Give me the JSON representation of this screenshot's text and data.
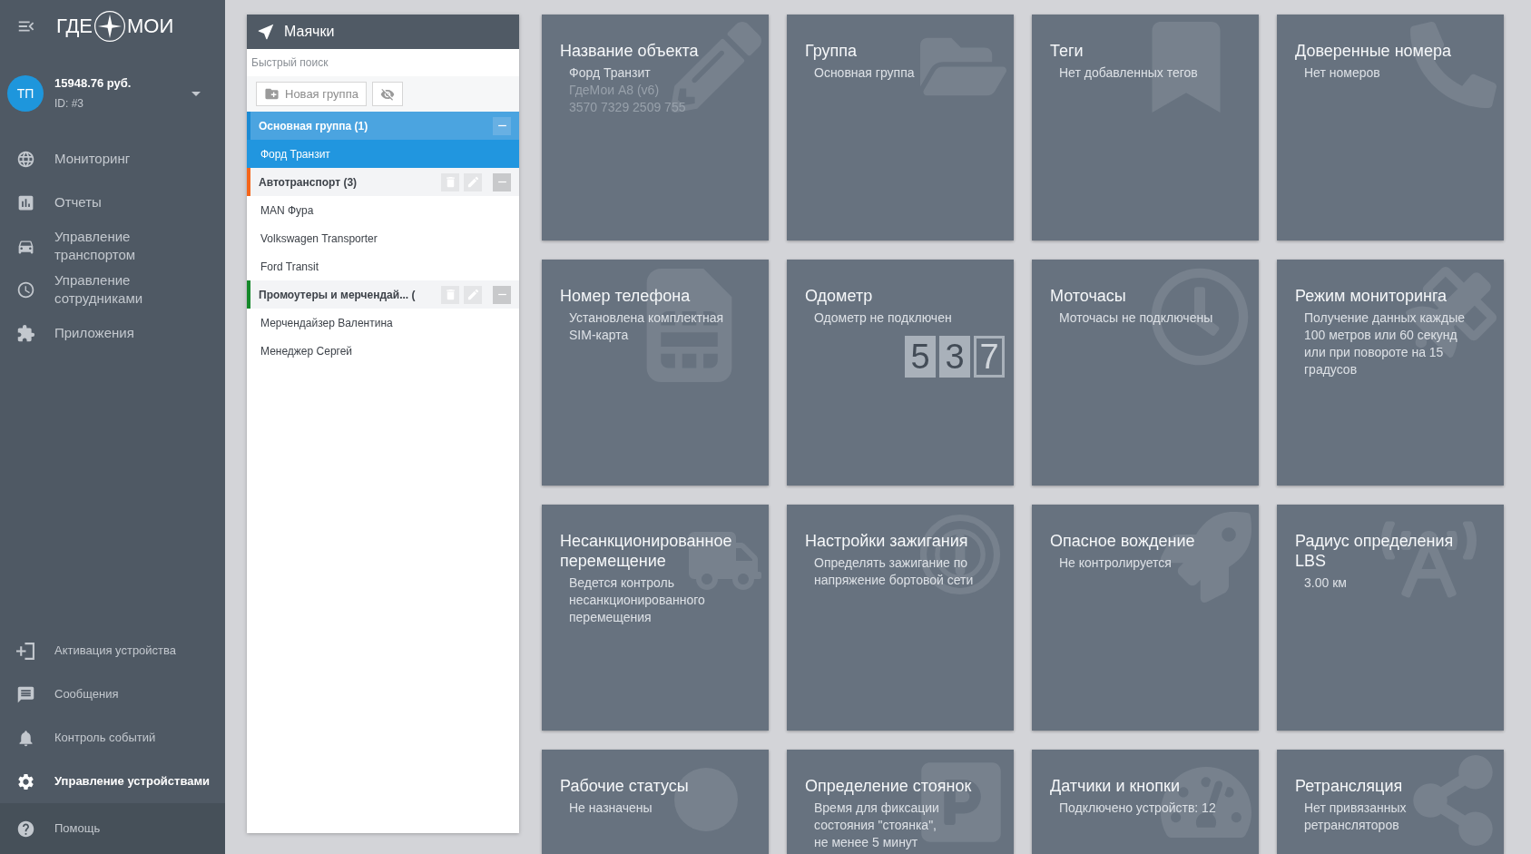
{
  "sidebar": {
    "logo": {
      "left": "ГДЕ",
      "right": "МОИ"
    },
    "account": {
      "initials": "ТП",
      "balance": "15948.76 руб.",
      "id": "ID: #3"
    },
    "nav": [
      {
        "label": "Мониторинг",
        "selected": false
      },
      {
        "label": "Отчеты",
        "selected": false
      },
      {
        "label": "Управление транспортом",
        "selected": false
      },
      {
        "label": "Управление сотрудниками",
        "selected": false
      },
      {
        "label": "Приложения",
        "selected": false
      }
    ],
    "bottom_nav": [
      {
        "label": "Активация устройства",
        "selected": false
      },
      {
        "label": "Сообщения",
        "selected": false
      },
      {
        "label": "Контроль событий",
        "selected": false
      },
      {
        "label": "Управление устройствами",
        "selected": true
      }
    ],
    "help": {
      "label": "Помощь"
    }
  },
  "beacons_panel": {
    "title": "Маячки",
    "search": {
      "placeholder": "Быстрый поиск"
    },
    "new_group_button": "Новая группа",
    "groups": [
      {
        "name": "Основная группа (1)",
        "color": "#1b8ad3",
        "selected": true,
        "expanded": true,
        "editable": false,
        "items": [
          {
            "name": "Форд Транзит",
            "selected": true
          }
        ]
      },
      {
        "name": "Автотранспорт (3)",
        "color": "#f5661b",
        "selected": false,
        "expanded": true,
        "editable": true,
        "items": [
          {
            "name": "MAN Фура",
            "selected": false
          },
          {
            "name": "Volkswagen Transporter",
            "selected": false
          },
          {
            "name": "Ford Transit",
            "selected": false
          }
        ]
      },
      {
        "name": "Промоутеры и мерчендай... (",
        "color": "#15892b",
        "selected": false,
        "expanded": true,
        "editable": true,
        "items": [
          {
            "name": "Мерчендайзер Валентина",
            "selected": false
          },
          {
            "name": "Менеджер Сергей",
            "selected": false
          }
        ]
      }
    ]
  },
  "tiles": [
    {
      "title": "Название объекта",
      "lines": [
        {
          "text": "Форд Транзит",
          "dimmed": false
        },
        {
          "text": "ГдеМои А8 (v6)",
          "dimmed": true
        },
        {
          "text": "3570 7329 2509 755",
          "dimmed": true
        }
      ]
    },
    {
      "title": "Группа",
      "lines": [
        {
          "text": "Основная группа",
          "dimmed": false
        }
      ]
    },
    {
      "title": "Теги",
      "lines": [
        {
          "text": "Нет добавленных тегов",
          "dimmed": false
        }
      ]
    },
    {
      "title": "Доверенные номера",
      "lines": [
        {
          "text": "Нет номеров",
          "dimmed": false
        }
      ]
    },
    {
      "title": "Номер телефона",
      "lines": [
        {
          "text": "Установлена комплектная SIM-карта",
          "dimmed": false
        }
      ]
    },
    {
      "title": "Одометр",
      "lines": [
        {
          "text": "Одометр не подключен",
          "dimmed": false
        }
      ],
      "counter_digits": [
        "5",
        "3",
        "7"
      ]
    },
    {
      "title": "Моточасы",
      "lines": [
        {
          "text": "Моточасы не подключены",
          "dimmed": false
        }
      ]
    },
    {
      "title": "Режим мониторинга",
      "lines": [
        {
          "text": "Получение данных каждые 100 метров или 60 секунд или при повороте на 15 градусов",
          "dimmed": false
        }
      ]
    },
    {
      "title": "Несанкционированное перемещение",
      "lines": [
        {
          "text": "Ведется контроль несанкционированного перемещения",
          "dimmed": false
        }
      ]
    },
    {
      "title": "Настройки зажигания",
      "lines": [
        {
          "text": "Определять зажигание по напряжение бортовой сети",
          "dimmed": false
        }
      ]
    },
    {
      "title": "Опасное вождение",
      "lines": [
        {
          "text": "Не контролируется",
          "dimmed": false
        }
      ]
    },
    {
      "title": "Радиус определения LBS",
      "lines": [
        {
          "text": "3.00 км",
          "dimmed": false
        }
      ]
    },
    {
      "title": "Рабочие статусы",
      "lines": [
        {
          "text": "Не назначены",
          "dimmed": false
        }
      ]
    },
    {
      "title": "Определение стоянок",
      "lines": [
        {
          "text": "Время для фиксации\nсостояния \"стоянка\",\nне менее 5 минут",
          "dimmed": false
        }
      ]
    },
    {
      "title": "Датчики и кнопки",
      "lines": [
        {
          "text": "Подключено устройств: 12",
          "dimmed": false
        }
      ]
    },
    {
      "title": "Ретрансляция",
      "lines": [
        {
          "text": "Нет привязанных ретрансляторов",
          "dimmed": false
        }
      ]
    }
  ]
}
